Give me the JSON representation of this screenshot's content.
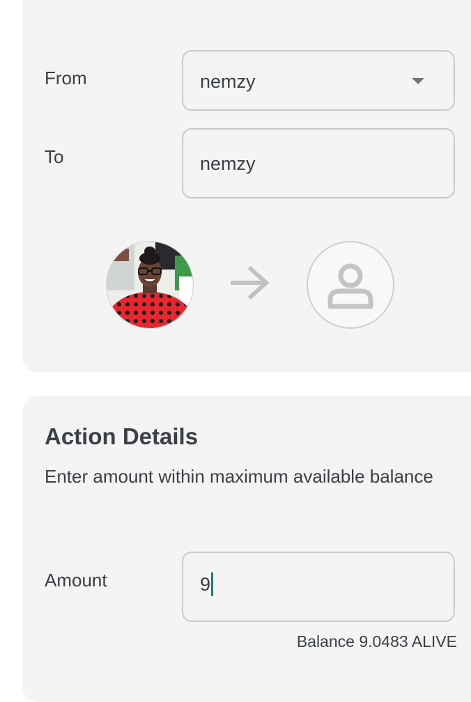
{
  "transfer": {
    "from_label": "From",
    "from_value": "nemzy",
    "to_label": "To",
    "to_value": "nemzy"
  },
  "action_details": {
    "title": "Action Details",
    "description": "Enter amount within maximum available balance",
    "amount_label": "Amount",
    "amount_value": "9",
    "balance_text": "Balance 9.0483 ALIVE"
  },
  "icons": {
    "dropdown": "chevron-down-icon",
    "arrow": "arrow-right-icon",
    "placeholder_avatar": "person-icon"
  },
  "colors": {
    "card_bg": "#f4f4f4",
    "text": "#3a3f45",
    "caret": "#1a7f74",
    "border": "#c9c9c9"
  }
}
